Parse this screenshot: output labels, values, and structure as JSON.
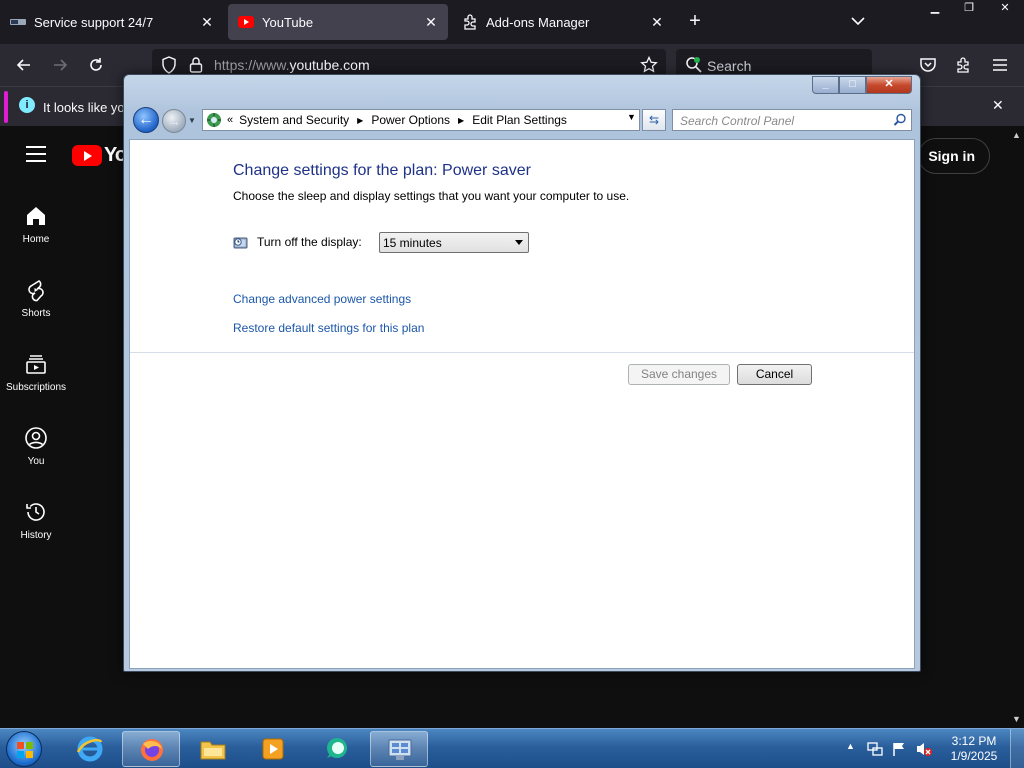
{
  "browser": {
    "tabs": [
      {
        "title": "Service support 24/7",
        "active": false
      },
      {
        "title": "YouTube",
        "active": true
      },
      {
        "title": "Add-ons Manager",
        "active": false
      }
    ],
    "url_prefix": "https://www.",
    "url_domain": "youtube.com",
    "search_placeholder": "Search",
    "notification": "It looks like yo"
  },
  "youtube": {
    "logo_text": "Yo",
    "sign_in": "Sign in",
    "nav": [
      {
        "label": "Home",
        "icon": "home-icon"
      },
      {
        "label": "Shorts",
        "icon": "shorts-icon"
      },
      {
        "label": "Subscriptions",
        "icon": "subscriptions-icon"
      },
      {
        "label": "You",
        "icon": "you-icon"
      },
      {
        "label": "History",
        "icon": "history-icon"
      }
    ]
  },
  "control_panel": {
    "breadcrumb": [
      "System and Security",
      "Power Options",
      "Edit Plan Settings"
    ],
    "search_placeholder": "Search Control Panel",
    "heading": "Change settings for the plan: Power saver",
    "subheading": "Choose the sleep and display settings that you want your computer to use.",
    "display_label": "Turn off the display:",
    "display_value": "15 minutes",
    "links": [
      "Change advanced power settings",
      "Restore default settings for this plan"
    ],
    "save_button": "Save changes",
    "save_enabled": false,
    "cancel_button": "Cancel"
  },
  "taskbar": {
    "time": "3:12 PM",
    "date": "1/9/2025",
    "pinned": [
      "internet-explorer-icon",
      "firefox-icon",
      "file-explorer-icon",
      "media-player-icon",
      "messenger-icon",
      "control-panel-icon"
    ]
  },
  "colors": {
    "accent_link": "#1c57a8",
    "heading": "#1e3287",
    "youtube_red": "#ff0000"
  }
}
